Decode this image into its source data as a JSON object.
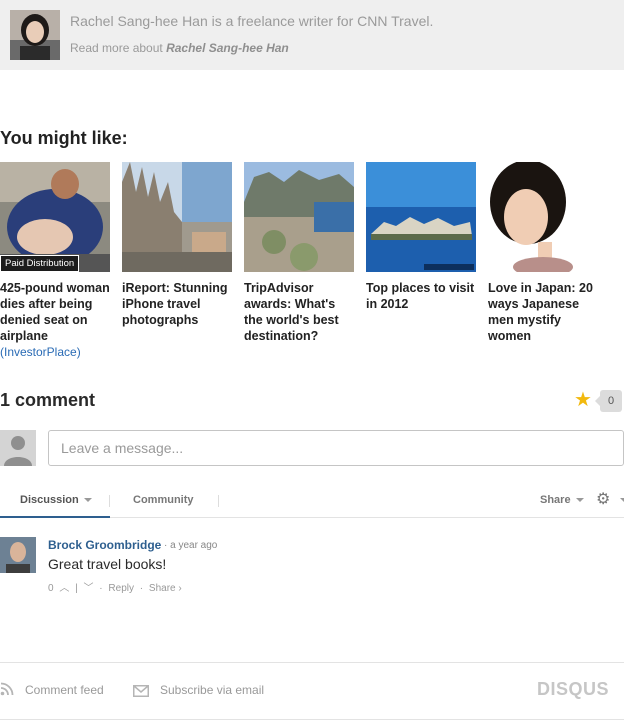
{
  "author_box": {
    "bio": "Rachel Sang-hee Han is a freelance writer for CNN Travel.",
    "read_more_prefix": "Read more about ",
    "read_more_name": "Rachel Sang-hee Han"
  },
  "you_might_like": {
    "heading": "You might like:",
    "items": [
      {
        "title": "425-pound woman dies after being denied seat on airplane",
        "source": "(InvestorPlace)",
        "badge": "Paid Distribution"
      },
      {
        "title": "iReport: Stunning iPhone travel photographs"
      },
      {
        "title": "TripAdvisor awards: What's the world's best destination?"
      },
      {
        "title": "Top places to visit in 2012"
      },
      {
        "title": "Love in Japan: 20 ways Japanese men mystify women"
      }
    ]
  },
  "comments": {
    "count_label": "1 comment",
    "star_count": "0",
    "star_color": "#f2b90e",
    "placeholder": "Leave a message..."
  },
  "tabs": {
    "discussion": "Discussion",
    "community": "Community",
    "share": "Share"
  },
  "comment": {
    "author": "Brock Groombridge",
    "time": "a year ago",
    "text": "Great travel books!",
    "votes": "0",
    "reply": "Reply",
    "share": "Share ›"
  },
  "footer": {
    "feed": "Comment feed",
    "subscribe": "Subscribe via email",
    "logo": "DISQUS"
  },
  "colors": {
    "link_blue": "#2e5f8f",
    "source_blue": "#2a6bb5",
    "author_box_bg": "#efefef"
  }
}
